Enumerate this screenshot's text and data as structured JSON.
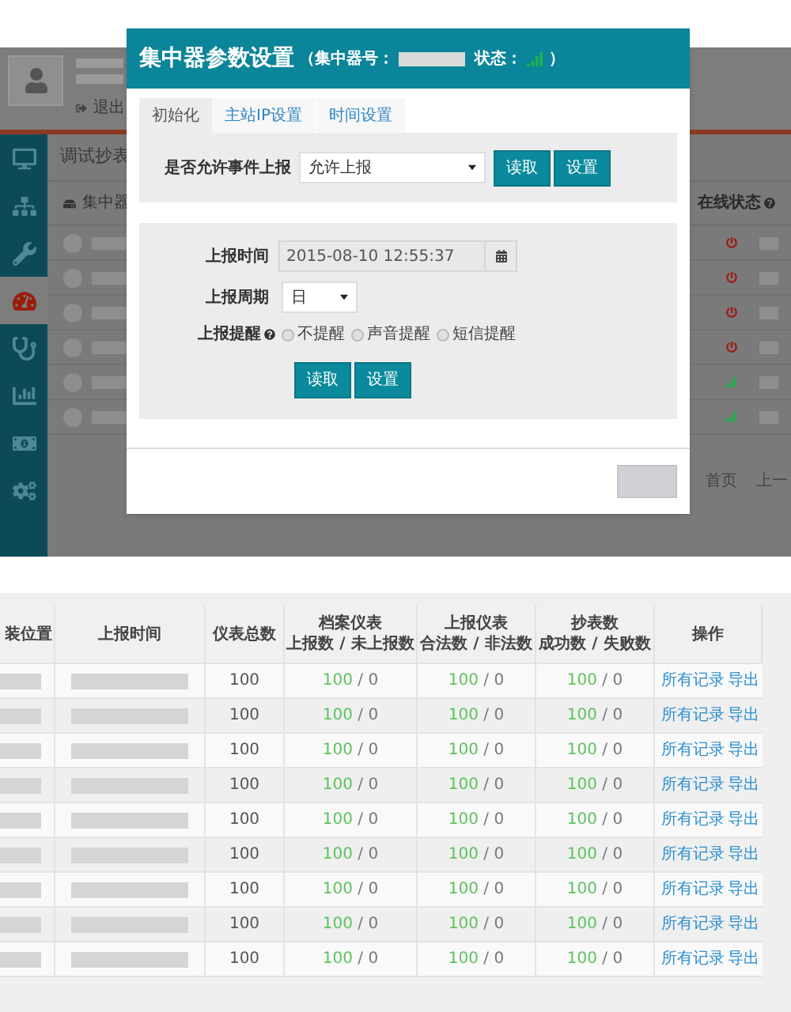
{
  "background_page": {
    "logout": "退出",
    "section_title": "调试抄表",
    "list_header": "集中器",
    "status_header": "在线状态",
    "sidebar": [
      {
        "selected": false
      },
      {
        "selected": false
      },
      {
        "selected": false
      },
      {
        "selected": true
      },
      {
        "selected": false
      },
      {
        "selected": false
      },
      {
        "selected": false
      },
      {
        "selected": false
      }
    ],
    "status_rows": [
      {
        "online": false
      },
      {
        "online": false
      },
      {
        "online": false
      },
      {
        "online": false
      },
      {
        "online": true
      },
      {
        "online": true
      }
    ],
    "pagination": [
      "首页",
      "上一"
    ]
  },
  "dialog": {
    "title": "集中器参数设置",
    "id_label": "（集中器号：",
    "status_label": "状态：",
    "close_paren": "）",
    "tabs": [
      {
        "label": "初始化",
        "selected": true
      },
      {
        "label": "主站IP设置",
        "selected": false
      },
      {
        "label": "时间设置",
        "selected": false
      }
    ],
    "event_report": {
      "label": "是否允许事件上报",
      "value": "允许上报",
      "buttons": [
        "读取",
        "设置"
      ]
    },
    "report_time": {
      "label": "上报时间",
      "value": "2015-08-10 12:55:37"
    },
    "report_cycle": {
      "label": "上报周期",
      "value": "日"
    },
    "reminder": {
      "label": "上报提醒",
      "options": [
        {
          "label": "不提醒",
          "selected": false
        },
        {
          "label": "声音提醒",
          "selected": false
        },
        {
          "label": "短信提醒",
          "selected": false
        }
      ]
    },
    "buttons": [
      "读取",
      "设置"
    ]
  },
  "table": {
    "columns": [
      {
        "lines": [
          "装位置"
        ]
      },
      {
        "lines": [
          "上报时间"
        ]
      },
      {
        "lines": [
          "仪表总数"
        ]
      },
      {
        "lines": [
          "档案仪表",
          "上报数 / 未上报数"
        ]
      },
      {
        "lines": [
          "上报仪表",
          "合法数 / 非法数"
        ]
      },
      {
        "lines": [
          "抄表数",
          "成功数 / 失败数"
        ]
      },
      {
        "lines": [
          "操作"
        ]
      }
    ],
    "rows": [
      {
        "total": "100",
        "archived": {
          "good": "100",
          "rest": "/ 0"
        },
        "reported": {
          "good": "100",
          "rest": "/ 0"
        },
        "reads": {
          "good": "100",
          "rest": "/ 0"
        },
        "actions": [
          "所有记录",
          "导出"
        ]
      },
      {
        "total": "100",
        "archived": {
          "good": "100",
          "rest": "/ 0"
        },
        "reported": {
          "good": "100",
          "rest": "/ 0"
        },
        "reads": {
          "good": "100",
          "rest": "/ 0"
        },
        "actions": [
          "所有记录",
          "导出"
        ]
      },
      {
        "total": "100",
        "archived": {
          "good": "100",
          "rest": "/ 0"
        },
        "reported": {
          "good": "100",
          "rest": "/ 0"
        },
        "reads": {
          "good": "100",
          "rest": "/ 0"
        },
        "actions": [
          "所有记录",
          "导出"
        ]
      },
      {
        "total": "100",
        "archived": {
          "good": "100",
          "rest": "/ 0"
        },
        "reported": {
          "good": "100",
          "rest": "/ 0"
        },
        "reads": {
          "good": "100",
          "rest": "/ 0"
        },
        "actions": [
          "所有记录",
          "导出"
        ]
      },
      {
        "total": "100",
        "archived": {
          "good": "100",
          "rest": "/ 0"
        },
        "reported": {
          "good": "100",
          "rest": "/ 0"
        },
        "reads": {
          "good": "100",
          "rest": "/ 0"
        },
        "actions": [
          "所有记录",
          "导出"
        ]
      },
      {
        "total": "100",
        "archived": {
          "good": "100",
          "rest": "/ 0"
        },
        "reported": {
          "good": "100",
          "rest": "/ 0"
        },
        "reads": {
          "good": "100",
          "rest": "/ 0"
        },
        "actions": [
          "所有记录",
          "导出"
        ]
      },
      {
        "total": "100",
        "archived": {
          "good": "100",
          "rest": "/ 0"
        },
        "reported": {
          "good": "100",
          "rest": "/ 0"
        },
        "reads": {
          "good": "100",
          "rest": "/ 0"
        },
        "actions": [
          "所有记录",
          "导出"
        ]
      },
      {
        "total": "100",
        "archived": {
          "good": "100",
          "rest": "/ 0"
        },
        "reported": {
          "good": "100",
          "rest": "/ 0"
        },
        "reads": {
          "good": "100",
          "rest": "/ 0"
        },
        "actions": [
          "所有记录",
          "导出"
        ]
      },
      {
        "total": "100",
        "archived": {
          "good": "100",
          "rest": "/ 0"
        },
        "reported": {
          "good": "100",
          "rest": "/ 0"
        },
        "reads": {
          "good": "100",
          "rest": "/ 0"
        },
        "actions": [
          "所有记录",
          "导出"
        ]
      }
    ]
  }
}
